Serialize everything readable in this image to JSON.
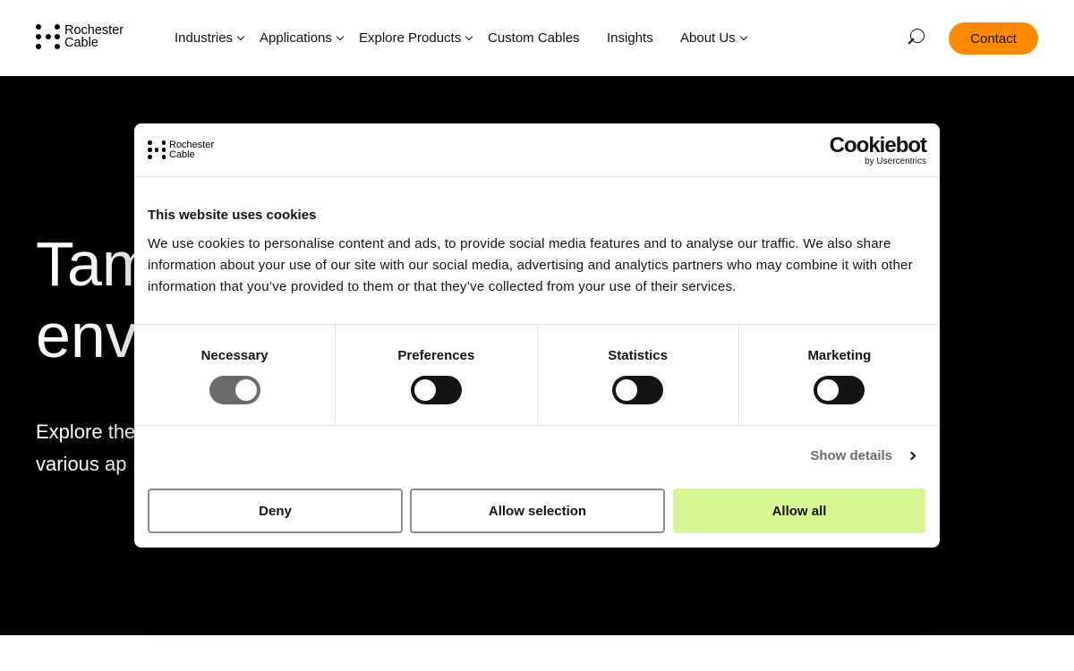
{
  "header": {
    "logo": {
      "line1": "Rochester",
      "line2": "Cable"
    },
    "nav": [
      {
        "label": "Industries",
        "has_dropdown": true
      },
      {
        "label": "Applications",
        "has_dropdown": true
      },
      {
        "label": "Explore Products",
        "has_dropdown": true
      },
      {
        "label": "Custom Cables",
        "has_dropdown": false
      },
      {
        "label": "Insights",
        "has_dropdown": false
      },
      {
        "label": "About Us",
        "has_dropdown": true
      }
    ],
    "search_icon": "search-icon",
    "contact_label": "Contact",
    "contact_color": "#ff8a00"
  },
  "hero": {
    "title_line1": "Tam",
    "title_line2": "env",
    "subtitle_line1": "Explore the",
    "subtitle_line2": "various ap"
  },
  "cookie_dialog": {
    "logo": {
      "line1": "Rochester",
      "line2": "Cable"
    },
    "cookiebot": {
      "main": "Cookiebot",
      "sub": "by Usercentrics"
    },
    "title": "This website uses cookies",
    "text": "We use cookies to personalise content and ads, to provide social media features and to analyse our traffic. We also share information about your use of our site with our social media, advertising and analytics partners who may combine it with other information that you’ve provided to them or that they’ve collected from your use of their services.",
    "toggles": [
      {
        "label": "Necessary",
        "state": "on"
      },
      {
        "label": "Preferences",
        "state": "off"
      },
      {
        "label": "Statistics",
        "state": "off"
      },
      {
        "label": "Marketing",
        "state": "off"
      }
    ],
    "show_details": "Show details",
    "buttons": {
      "deny": "Deny",
      "allow_selection": "Allow selection",
      "allow_all": "Allow all"
    },
    "allow_all_color": "#d6f794"
  }
}
